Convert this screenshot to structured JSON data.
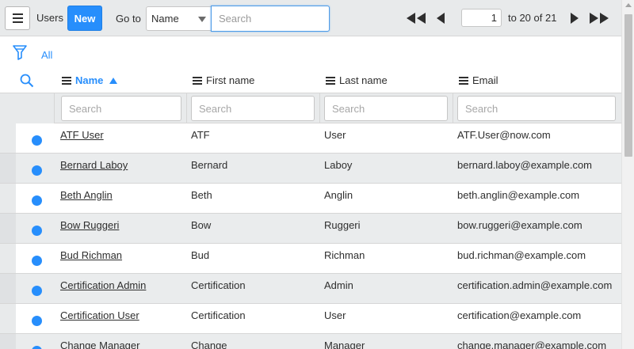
{
  "header": {
    "list_title": "Users",
    "new_label": "New",
    "goto_label": "Go to",
    "goto_field": "Name",
    "search_placeholder": "Search"
  },
  "pager": {
    "current_page": "1",
    "range_text": "to 20 of 21"
  },
  "filter": {
    "label": "All"
  },
  "columns": [
    {
      "label": "Name",
      "sorted": "ascending"
    },
    {
      "label": "First name"
    },
    {
      "label": "Last name"
    },
    {
      "label": "Email"
    }
  ],
  "column_search_placeholder": "Search",
  "rows": [
    {
      "name": "ATF User",
      "first": "ATF",
      "last": "User",
      "email": "ATF.User@now.com"
    },
    {
      "name": "Bernard Laboy",
      "first": "Bernard",
      "last": "Laboy",
      "email": "bernard.laboy@example.com"
    },
    {
      "name": "Beth Anglin",
      "first": "Beth",
      "last": "Anglin",
      "email": "beth.anglin@example.com"
    },
    {
      "name": "Bow Ruggeri",
      "first": "Bow",
      "last": "Ruggeri",
      "email": "bow.ruggeri@example.com"
    },
    {
      "name": "Bud Richman",
      "first": "Bud",
      "last": "Richman",
      "email": "bud.richman@example.com"
    },
    {
      "name": "Certification Admin",
      "first": "Certification",
      "last": "Admin",
      "email": "certification.admin@example.com"
    },
    {
      "name": "Certification User",
      "first": "Certification",
      "last": "User",
      "email": "certification@example.com"
    },
    {
      "name": "Change Manager",
      "first": "Change",
      "last": "Manager",
      "email": "change.manager@example.com"
    }
  ],
  "colors": {
    "accent": "#278efc",
    "header_bg": "#e8eaeb",
    "row_alt_bg": "#eaeced"
  }
}
